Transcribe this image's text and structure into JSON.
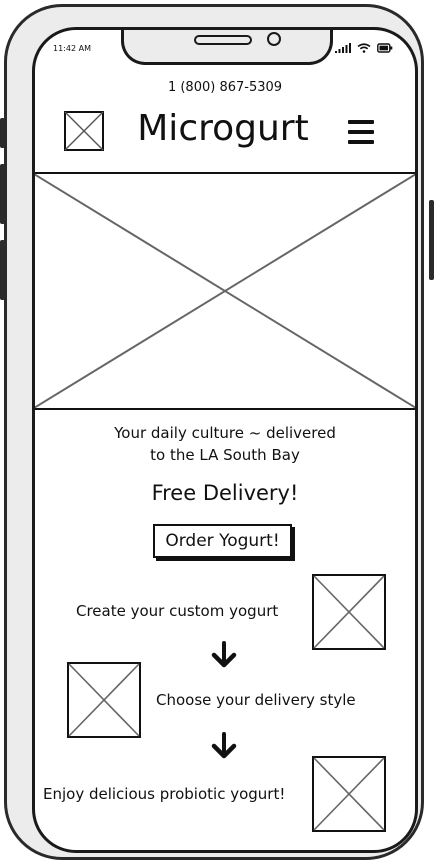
{
  "status_bar": {
    "time": "11:42 AM",
    "icons": [
      "signal-icon",
      "wifi-icon",
      "battery-icon"
    ]
  },
  "header": {
    "phone": "1 (800) 867-5309",
    "brand": "Microgurt",
    "logo_icon": "image-placeholder-icon",
    "menu_icon": "hamburger-menu-icon"
  },
  "hero": {
    "icon": "image-placeholder-icon"
  },
  "intro": {
    "tagline_line1": "Your daily culture ~ delivered",
    "tagline_line2": "to the LA South Bay",
    "free_delivery": "Free Delivery!",
    "order_button": "Order Yogurt!"
  },
  "steps": [
    {
      "label": "Create your custom yogurt"
    },
    {
      "label": "Choose your delivery style"
    },
    {
      "label": "Enjoy delicious probiotic yogurt!"
    }
  ],
  "colors": {
    "ink": "#111111",
    "frame": "#2a2a2a",
    "bezel": "#ececec",
    "placeholder_line": "#666666"
  }
}
